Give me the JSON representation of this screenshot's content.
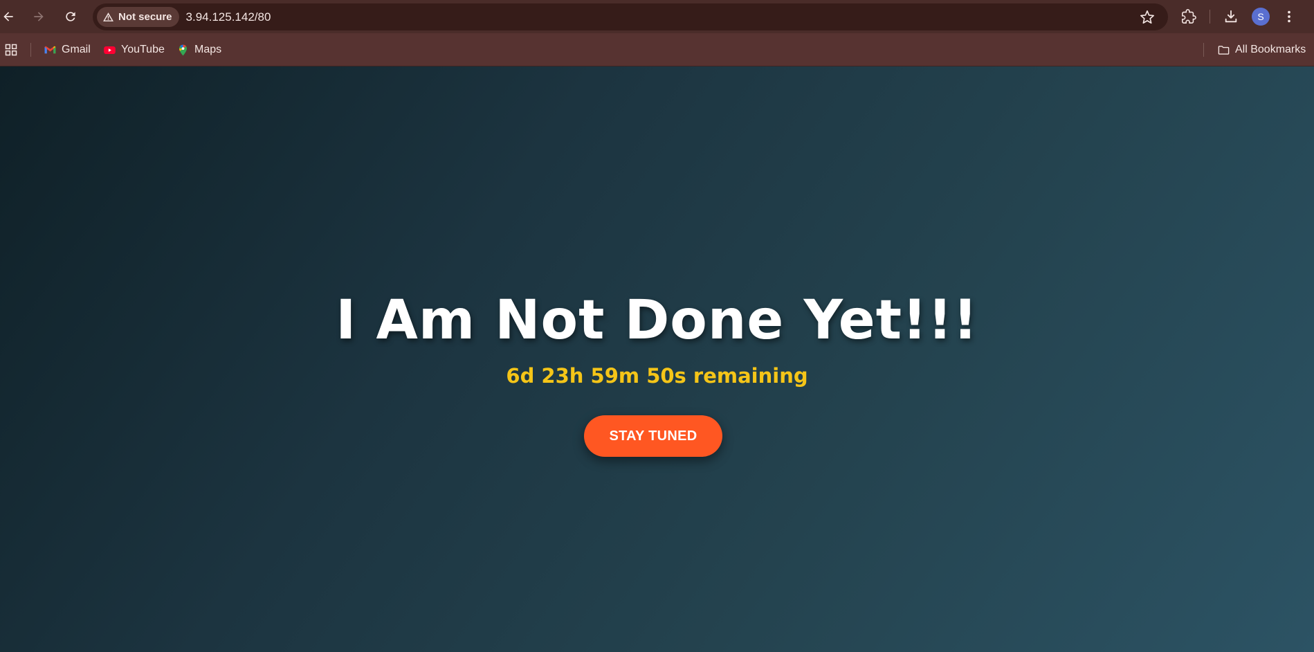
{
  "browser": {
    "security_label": "Not secure",
    "url": "3.94.125.142/80",
    "profile_initial": "S",
    "icons": {
      "back": "arrow-left-icon",
      "forward": "arrow-right-icon",
      "reload": "reload-icon",
      "security": "warning-triangle-icon",
      "bookmark_star": "star-icon",
      "extensions": "puzzle-icon",
      "downloads": "download-icon",
      "menu": "kebab-menu-icon"
    }
  },
  "bookmarks": {
    "items": [
      {
        "label": "Gmail",
        "icon": "gmail-icon"
      },
      {
        "label": "YouTube",
        "icon": "youtube-icon"
      },
      {
        "label": "Maps",
        "icon": "maps-icon"
      }
    ],
    "all_bookmarks_label": "All Bookmarks"
  },
  "page": {
    "headline": "I Am Not Done Yet!!!",
    "countdown": "6d 23h 59m 50s remaining",
    "cta_label": "STAY TUNED"
  },
  "colors": {
    "toolbar_bg": "#4a2c29",
    "bookmarks_bg": "#573331",
    "accent_cta": "#ff5722",
    "countdown_text": "#f5c518",
    "page_gradient_start": "#0f2027",
    "page_gradient_end": "#2c5364"
  }
}
